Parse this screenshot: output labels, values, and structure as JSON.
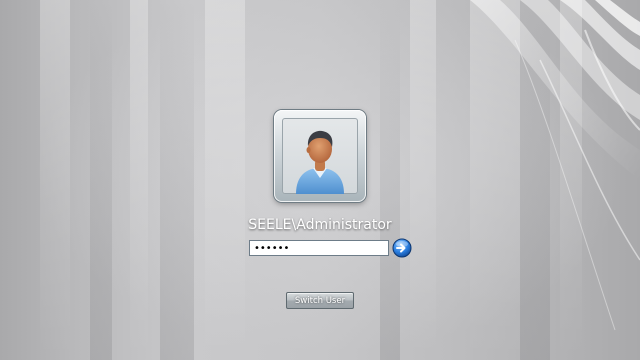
{
  "user": {
    "name": "SEELE\\Administrator",
    "avatar_icon": "user-avatar-icon"
  },
  "password": {
    "value": "••••••"
  },
  "go_button": {
    "icon": "arrow-right-icon",
    "color": "#1e6fd0"
  },
  "switch_user": {
    "label": "Switch User"
  },
  "background": {
    "color": "#c4c4c6"
  }
}
